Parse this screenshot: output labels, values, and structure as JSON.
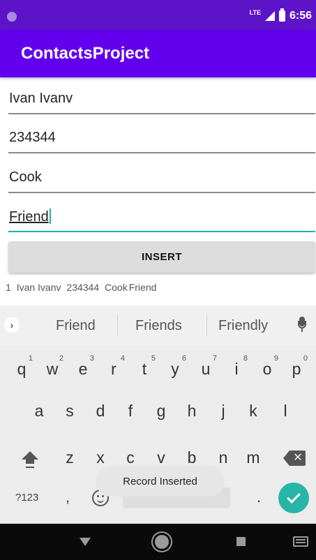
{
  "status_bar": {
    "network_label": "LTE",
    "time": "6:56"
  },
  "app_bar": {
    "title": "ContactsProject"
  },
  "form": {
    "fields": [
      {
        "value": "Ivan Ivanv"
      },
      {
        "value": "234344"
      },
      {
        "value": "Cook"
      },
      {
        "value": "Friend"
      }
    ],
    "insert_label": "INSERT"
  },
  "record": {
    "id": "1",
    "name": "Ivan Ivanv",
    "phone": "234344",
    "job": "Cook",
    "relation": "Friend"
  },
  "keyboard": {
    "suggestions": [
      "Friend",
      "Friends",
      "Friendly"
    ],
    "row1": [
      {
        "key": "q",
        "hint": "1"
      },
      {
        "key": "w",
        "hint": "2"
      },
      {
        "key": "e",
        "hint": "3"
      },
      {
        "key": "r",
        "hint": "4"
      },
      {
        "key": "t",
        "hint": "5"
      },
      {
        "key": "y",
        "hint": "6"
      },
      {
        "key": "u",
        "hint": "7"
      },
      {
        "key": "i",
        "hint": "8"
      },
      {
        "key": "o",
        "hint": "9"
      },
      {
        "key": "p",
        "hint": "0"
      }
    ],
    "row2": [
      "a",
      "s",
      "d",
      "f",
      "g",
      "h",
      "j",
      "k",
      "l"
    ],
    "row3": [
      "z",
      "x",
      "c",
      "v",
      "b",
      "n",
      "m"
    ],
    "symbols_label": "?123",
    "comma_label": ",",
    "period_label": "."
  },
  "toast": {
    "text": "Record Inserted"
  },
  "colors": {
    "status_bar": "#5d14c9",
    "app_bar": "#6200ee",
    "accent": "#1bb3a8",
    "enter": "#27b5a8"
  }
}
